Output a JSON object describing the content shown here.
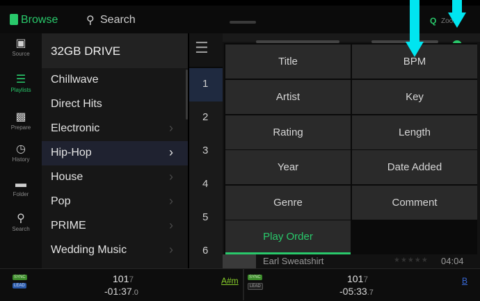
{
  "header": {
    "browse_label": "Browse",
    "search_label": "Search",
    "q_label": "Q",
    "zoom_label": "Zoom",
    "accent_color": "#29c96b"
  },
  "rail": {
    "items": [
      {
        "label": "Source",
        "icon": "drive-icon"
      },
      {
        "label": "Playlists",
        "icon": "playlist-icon"
      },
      {
        "label": "Prepare",
        "icon": "prepare-icon"
      },
      {
        "label": "History",
        "icon": "history-clock-icon"
      },
      {
        "label": "Folder",
        "icon": "folder-icon"
      },
      {
        "label": "Search",
        "icon": "search-icon"
      }
    ],
    "active": "Playlists"
  },
  "playlists": {
    "drive_label": "32GB DRIVE",
    "items": [
      {
        "label": "Chillwave",
        "has_children": false
      },
      {
        "label": "Direct Hits",
        "has_children": false
      },
      {
        "label": "Electronic",
        "has_children": true
      },
      {
        "label": "Hip-Hop",
        "has_children": true,
        "selected": true
      },
      {
        "label": "House",
        "has_children": true
      },
      {
        "label": "Pop",
        "has_children": true
      },
      {
        "label": "PRIME",
        "has_children": true
      },
      {
        "label": "Wedding Music",
        "has_children": true
      }
    ]
  },
  "tracks": {
    "numbers": [
      "1",
      "2",
      "3",
      "4",
      "5",
      "6"
    ],
    "visible_artist": "Earl Sweatshirt",
    "visible_duration": "04:04"
  },
  "sort_menu": {
    "left": [
      "Title",
      "Artist",
      "Rating",
      "Year",
      "Genre",
      "Play Order"
    ],
    "right": [
      "BPM",
      "Key",
      "Length",
      "Date Added",
      "Comment"
    ],
    "active": "Play Order"
  },
  "deck_left": {
    "sync": "SYNC",
    "lead": "LEAD",
    "bpm": "101",
    "bpm_decimal": "7",
    "time": "-01:37",
    "time_decimal": ".0",
    "key": "A#m"
  },
  "deck_right": {
    "sync": "SYNC",
    "lead": "LEAD",
    "bpm": "101",
    "bpm_decimal": "7",
    "time": "-05:33",
    "time_decimal": ".7",
    "key": "B"
  }
}
